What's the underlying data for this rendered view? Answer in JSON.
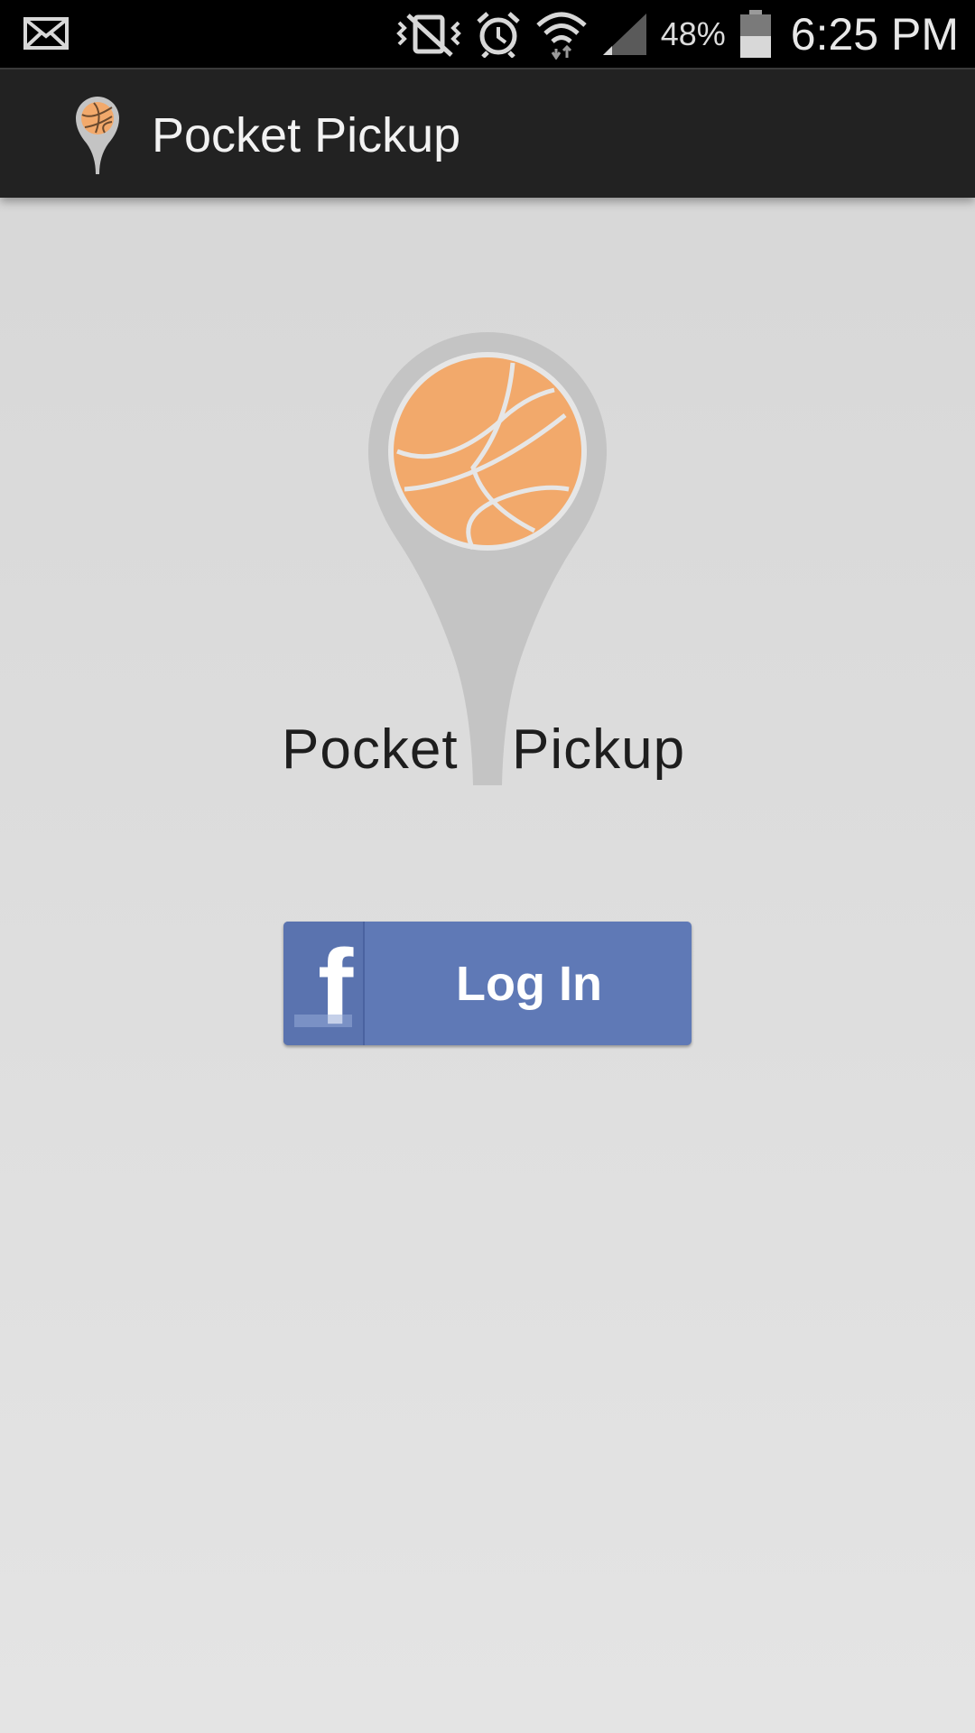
{
  "status_bar": {
    "battery_percent": "48%",
    "time": "6:25 PM",
    "icons": [
      "email-notification-icon",
      "vibrate-mute-icon",
      "alarm-icon",
      "wifi-icon",
      "cell-signal-icon",
      "battery-icon"
    ]
  },
  "action_bar": {
    "title": "Pocket Pickup",
    "icon": "pocket-pickup-pin-icon"
  },
  "logo": {
    "word_left": "Pocket",
    "word_right": "Pickup",
    "colors": {
      "ball": "#F2A96B",
      "pin": "#C4C4C4",
      "seams": "#E6E6E6"
    }
  },
  "login": {
    "button_label": "Log In",
    "brand_glyph": "f",
    "color": "#5F79B6"
  }
}
